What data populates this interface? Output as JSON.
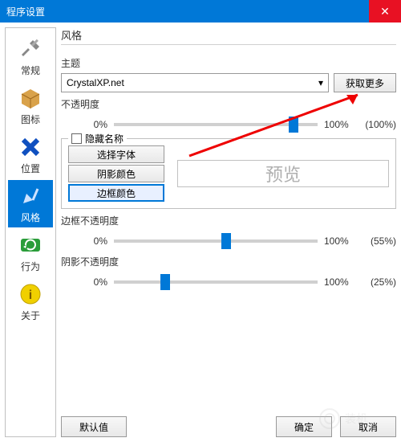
{
  "window": {
    "title": "程序设置"
  },
  "sidebar": {
    "items": [
      {
        "label": "常规"
      },
      {
        "label": "图标"
      },
      {
        "label": "位置"
      },
      {
        "label": "风格"
      },
      {
        "label": "行为"
      },
      {
        "label": "关于"
      }
    ]
  },
  "main": {
    "section": "风格",
    "theme_label": "主题",
    "theme_value": "CrystalXP.net",
    "get_more": "获取更多",
    "opacity_label": "不透明度",
    "opacity": {
      "left": "0%",
      "right": "100%",
      "value": "(100%)",
      "pos": 88
    },
    "hidename": {
      "legend": "隐藏名称",
      "buttons": [
        {
          "label": "选择字体"
        },
        {
          "label": "阴影颜色"
        },
        {
          "label": "边框颜色"
        }
      ],
      "preview": "预览"
    },
    "border_opacity_label": "边框不透明度",
    "border_opacity": {
      "left": "0%",
      "right": "100%",
      "value": "(55%)",
      "pos": 55
    },
    "shadow_opacity_label": "阴影不透明度",
    "shadow_opacity": {
      "left": "0%",
      "right": "100%",
      "value": "(25%)",
      "pos": 25
    }
  },
  "footer": {
    "default": "默认值",
    "ok": "确定",
    "cancel": "取消"
  }
}
